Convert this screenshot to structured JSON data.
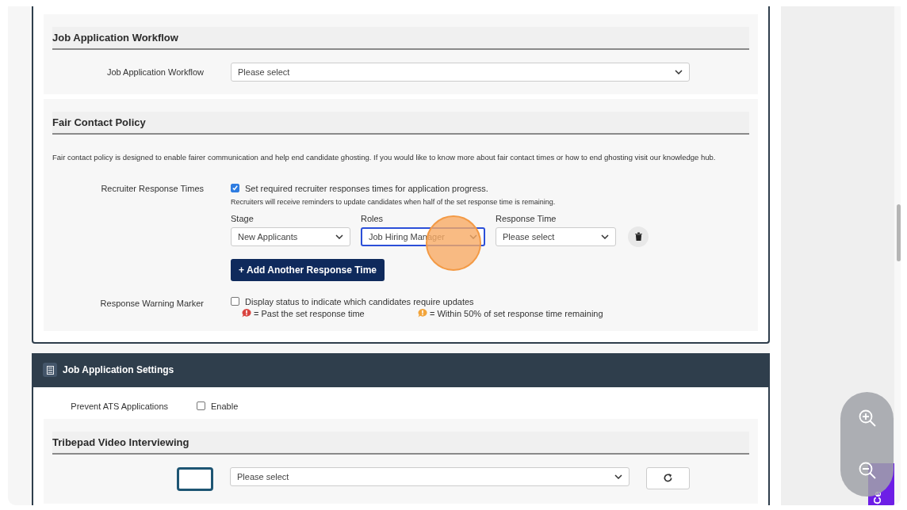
{
  "workflow_section": {
    "title": "Job Application Workflow",
    "field": {
      "label": "Job Application Workflow",
      "value": "Please select"
    }
  },
  "fair_contact_section": {
    "title": "Fair Contact Policy",
    "description": "Fair contact policy is designed to enable fairer communication and help end candidate ghosting. If you would like to know more about fair contact times or how to end ghosting visit our knowledge hub.",
    "response_times": {
      "label": "Recruiter Response Times",
      "checkbox": {
        "label": "Set required recruiter responses times for application progress.",
        "checked": true
      },
      "note": "Recruiters will receive reminders to update candidates when half of the set response time is remaining.",
      "rules": [
        {
          "stage": {
            "label": "Stage",
            "value": "New Applicants",
            "focused": false
          },
          "roles": {
            "label": "Roles",
            "value": "Job Hiring Manager",
            "focused": true
          },
          "response_time": {
            "label": "Response Time",
            "value": "Please select",
            "focused": false
          }
        }
      ],
      "add_button": {
        "icon": "+",
        "label": "Add Another Response Time"
      }
    },
    "warning_marker": {
      "label": "Response Warning Marker",
      "checkbox": {
        "label": "Display status to indicate which candidates require updates",
        "checked": false
      },
      "legend": [
        {
          "text": "= Past the set response time",
          "color": "#d9443f"
        },
        {
          "text": "= Within 50% of set response time remaining",
          "color": "#f2a43a"
        }
      ]
    }
  },
  "settings_card": {
    "title": "Job Application Settings",
    "prevent_ats": {
      "label": "Prevent ATS Applications",
      "checkbox": {
        "label": "Enable",
        "checked": false
      }
    },
    "video_section": {
      "title": "Tribepad Video Interviewing",
      "select": {
        "value": "Please select"
      }
    }
  },
  "side_tab": {
    "label": "Ce"
  }
}
